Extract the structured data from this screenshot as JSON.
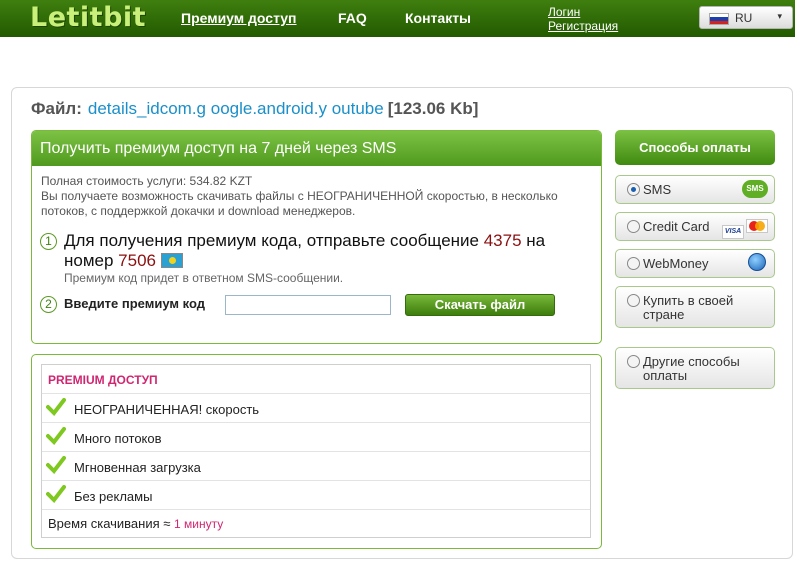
{
  "header": {
    "logo": "Letitbit",
    "nav": {
      "premium": "Премиум доступ",
      "faq": "FAQ",
      "contacts": "Контакты"
    },
    "auth": {
      "login": "Логин",
      "register": "Регистрация"
    },
    "language": {
      "selected": "RU",
      "arrow": "▾"
    }
  },
  "file": {
    "label": "Файл:",
    "name": "details_idcom.g oogle.android.y outube",
    "size": "[123.06 Kb]"
  },
  "sms": {
    "title": "Получить премиум доступ на 7 дней через SMS",
    "cost": "Полная стоимость услуги: 534.82 KZT",
    "description": "Вы получаете возможность скачивать файлы с НЕОГРАНИЧЕННОЙ скоростью, в несколько потоков, с поддержкой докачки и download менеджеров.",
    "step1": {
      "num": "1",
      "text_a": "Для получения премиум кода, отправьте сообщение ",
      "message": "4375",
      "text_b": " на номер ",
      "number": "7506",
      "note": "Премиум код придет в ответном SMS-сообщении."
    },
    "step2": {
      "num": "2",
      "label": "Введите премиум код",
      "input_value": "",
      "button": "Скачать файл"
    }
  },
  "premium": {
    "title": "PREMIUM ДОСТУП",
    "features": [
      "НЕОГРАНИЧЕННАЯ! скорость",
      "Много потоков",
      "Мгновенная загрузка",
      "Без рекламы"
    ],
    "time_label": "Время скачивания",
    "time_approx": "≈",
    "time_value": "1 минуту"
  },
  "payment": {
    "title": "Способы оплаты",
    "options": [
      {
        "label": "SMS",
        "selected": true,
        "badge": "SMS"
      },
      {
        "label": "Credit Card",
        "selected": false,
        "badge": "VISA"
      },
      {
        "label": "WebMoney",
        "selected": false
      },
      {
        "label": "Купить в своей стране",
        "selected": false
      },
      {
        "label": "Другие способы оплаты",
        "selected": false
      }
    ]
  },
  "colors": {
    "brand_green": "#3f7f0f",
    "link_blue": "#1a8fc9",
    "accent_pink": "#d02670",
    "highlight_red": "#8a1010"
  }
}
